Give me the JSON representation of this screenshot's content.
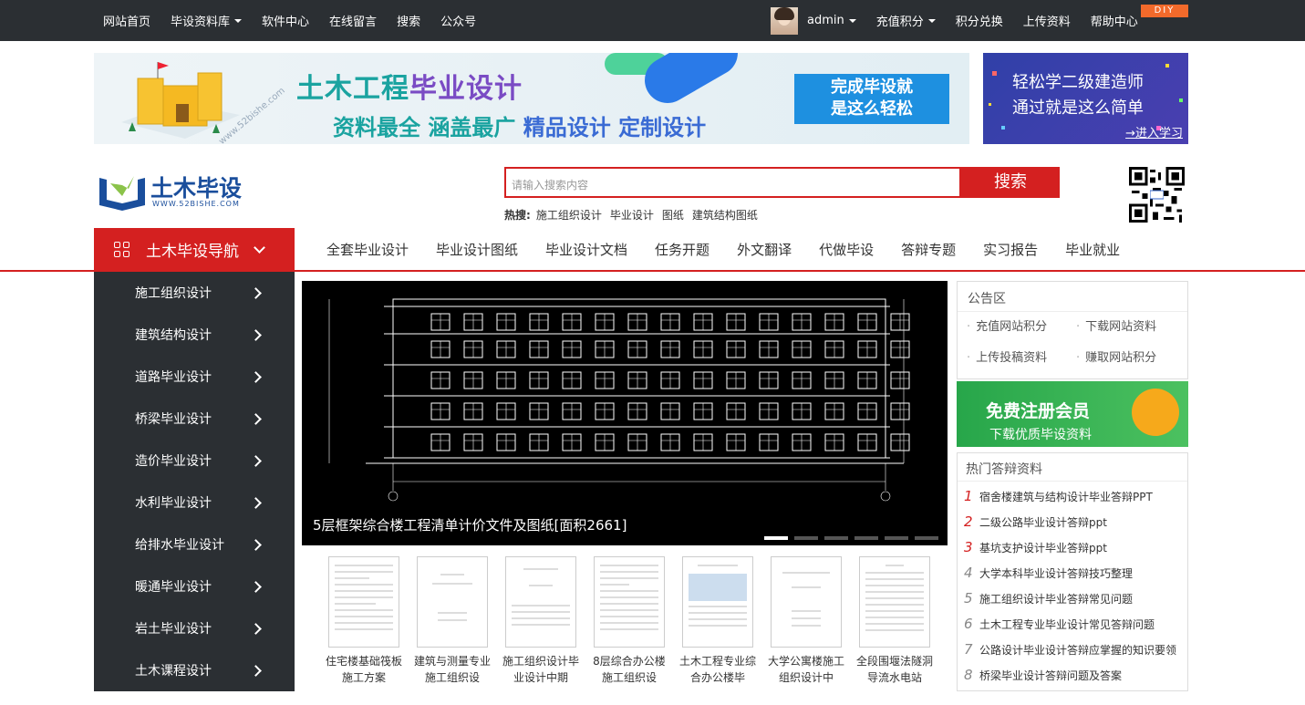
{
  "topbar": {
    "links": [
      "网站首页",
      "毕设资料库",
      "软件中心",
      "在线留言",
      "搜索",
      "公众号"
    ],
    "user": "admin",
    "right": [
      "充值积分",
      "积分兑换",
      "上传资料",
      "帮助中心"
    ],
    "diy": "DIY"
  },
  "banner1": {
    "url_text": "www.52bishe.com",
    "title_a": "土木工程",
    "title_b": "毕业设计",
    "sub_a": "资料最全 涵盖最广 ",
    "sub_b": "精品设计 定制设计",
    "btn_l1": "完成毕设就",
    "btn_l2": "是这么轻松"
  },
  "banner2": {
    "l1": "轻松学二级建造师",
    "l2": "通过就是这么简单",
    "l3": "→进入学习"
  },
  "logo": {
    "name": "土木毕设",
    "url": "WWW.52BISHE.COM"
  },
  "search": {
    "placeholder": "请输入搜索内容",
    "button": "搜索",
    "hot_label": "热搜:",
    "hot": [
      "施工组织设计",
      "毕业设计",
      "图纸",
      "建筑结构图纸"
    ]
  },
  "nav": {
    "head": "土木毕设导航",
    "links": [
      "全套毕业设计",
      "毕业设计图纸",
      "毕业设计文档",
      "任务开题",
      "外文翻译",
      "代做毕设",
      "答辩专题",
      "实习报告",
      "毕业就业"
    ]
  },
  "sidebar": [
    "施工组织设计",
    "建筑结构设计",
    "道路毕业设计",
    "桥梁毕业设计",
    "造价毕业设计",
    "水利毕业设计",
    "给排水毕业设计",
    "暖通毕业设计",
    "岩土毕业设计",
    "土木课程设计"
  ],
  "slider": {
    "caption": "5层框架综合楼工程清单计价文件及图纸[面积2661]"
  },
  "thumbs": [
    {
      "title": "住宅楼基础筏板施工方案"
    },
    {
      "title": "建筑与测量专业施工组织设"
    },
    {
      "title": "施工组织设计毕业设计中期"
    },
    {
      "title": "8层综合办公楼施工组织设"
    },
    {
      "title": "土木工程专业综合办公楼毕"
    },
    {
      "title": "大学公寓楼施工组织设计中"
    },
    {
      "title": "全段围堰法隧洞导流水电站"
    }
  ],
  "notice": {
    "title": "公告区",
    "items": [
      "充值网站积分",
      "下载网站资料",
      "上传投稿资料",
      "赚取网站积分"
    ]
  },
  "register": {
    "a": "免费注册会员",
    "b": "下载优质毕设资料"
  },
  "hot_answers": {
    "title": "热门答辩资料",
    "items": [
      {
        "n": "1",
        "t": "宿舍楼建筑与结构设计毕业答辩PPT"
      },
      {
        "n": "2",
        "t": "二级公路毕业设计答辩ppt"
      },
      {
        "n": "3",
        "t": "基坑支护设计毕业答辩ppt"
      },
      {
        "n": "4",
        "t": "大学本科毕业设计答辩技巧整理"
      },
      {
        "n": "5",
        "t": "施工组织设计毕业答辩常见问题"
      },
      {
        "n": "6",
        "t": "土木工程专业毕业设计常见答辩问题"
      },
      {
        "n": "7",
        "t": "公路设计毕业设计答辩应掌握的知识要领"
      },
      {
        "n": "8",
        "t": "桥梁毕业设计答辩问题及答案"
      }
    ]
  }
}
